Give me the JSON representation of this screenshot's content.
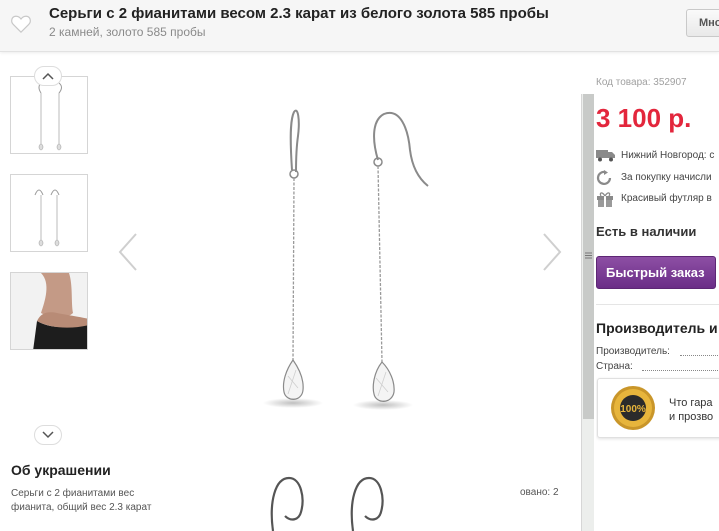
{
  "header": {
    "title": "Серьги с 2 фианитами весом 2.3 карат из белого золота 585 пробы",
    "subtitle": "2 камней, золото 585 пробы",
    "more_button": "Мно"
  },
  "gallery": {
    "thumbnails": [
      "earrings-front",
      "earrings-side",
      "model-wearing"
    ]
  },
  "about": {
    "title": "Об украшении",
    "text_line1": "Серьги с 2 фианитами вес",
    "text_line2": "фианита, общий вес 2.3 карат",
    "text_right": "овано: 2"
  },
  "product": {
    "code": "Код товара: 352907",
    "price": "3 100 р.",
    "delivery": "Нижний Новгород: с",
    "bonus": "За покупку начисли",
    "gift_box": "Красивый футляр в",
    "stock": "Есть в наличии",
    "quick_order_button": "Быстрый заказ"
  },
  "maker": {
    "title": "Производитель и",
    "manufacturer_label": "Производитель:",
    "country_label": "Страна:"
  },
  "guarantee": {
    "seal_text": "100%",
    "line1": "Что гара",
    "line2": "и прозво"
  },
  "colors": {
    "price": "#e3263c",
    "button": "#7a3a93"
  }
}
